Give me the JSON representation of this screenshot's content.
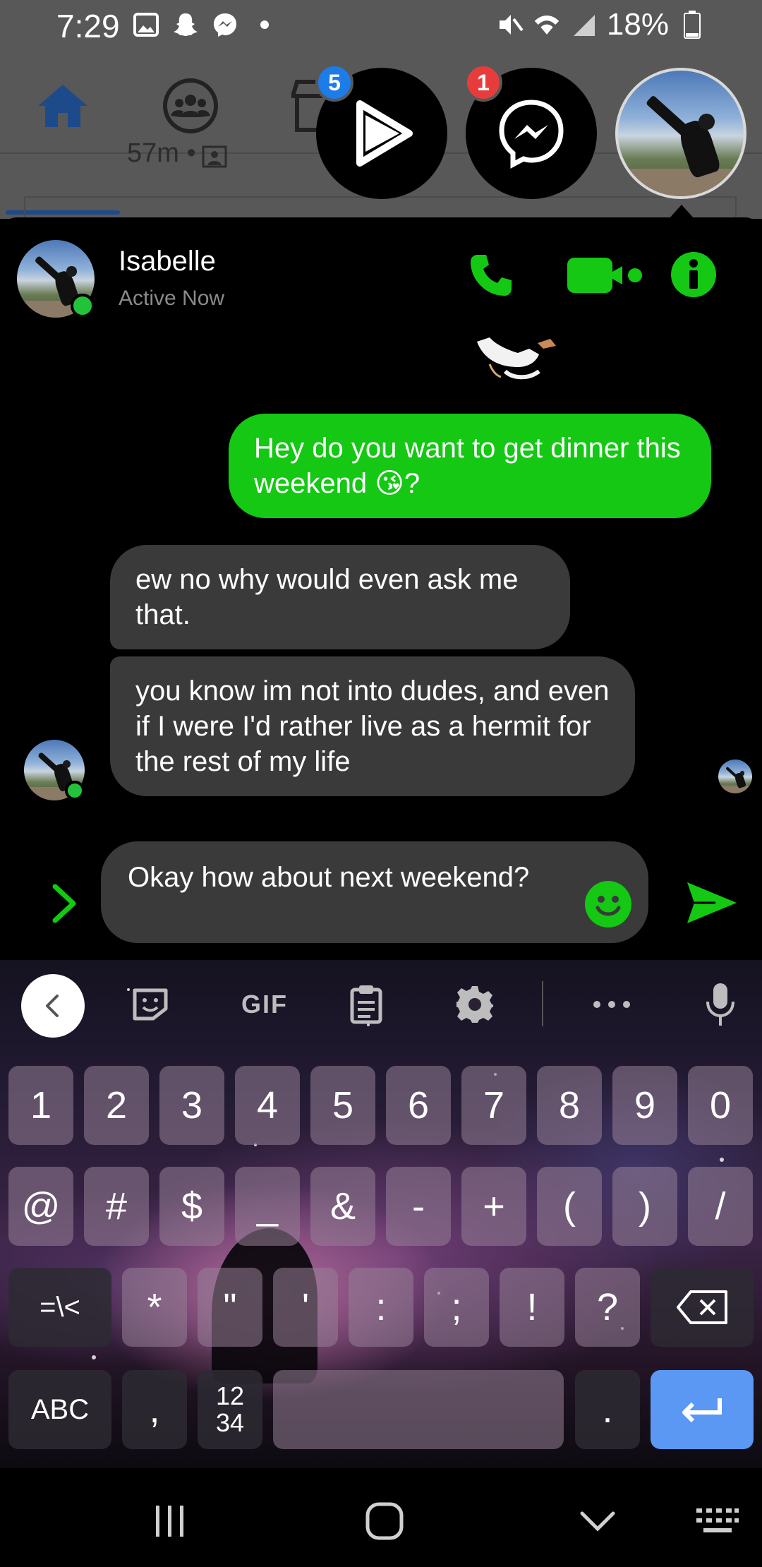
{
  "status_bar": {
    "time": "7:29",
    "battery": "18%"
  },
  "fb_backdrop": {
    "peek_text": "57m •"
  },
  "chat_heads": {
    "watch_badge": "5",
    "messenger_badge": "1"
  },
  "conversation": {
    "contact_name": "Isabelle",
    "contact_status": "Active Now",
    "messages": [
      {
        "from": "me",
        "text": "Hey do you want to get dinner this weekend 😘?"
      },
      {
        "from": "them",
        "text": "ew no why would even ask me that."
      },
      {
        "from": "them",
        "text": "you know im not into dudes, and even if I were I'd rather live as a hermit for the rest of my life"
      }
    ],
    "composer_text": "Okay how about next weekend?"
  },
  "keyboard": {
    "toolbar": {
      "gif_label": "GIF"
    },
    "rows": [
      [
        "1",
        "2",
        "3",
        "4",
        "5",
        "6",
        "7",
        "8",
        "9",
        "0"
      ],
      [
        "@",
        "#",
        "$",
        "_",
        "&",
        "-",
        "+",
        "(",
        ")",
        "/"
      ],
      [
        "=\\<",
        "*",
        "\"",
        "'",
        ":",
        ";",
        "!",
        "?"
      ],
      [
        "ABC",
        ",",
        "12\n34",
        ".",
        ""
      ]
    ],
    "abc_label": "ABC",
    "symbols_toggle_label": "=\\<",
    "numpad_top": "12",
    "numpad_bottom": "34"
  },
  "colors": {
    "accent_green": "#14c814",
    "incoming_bubble": "#3a3a3a",
    "enter_key": "#5a98f4",
    "fb_blue": "#1d4a8a"
  }
}
